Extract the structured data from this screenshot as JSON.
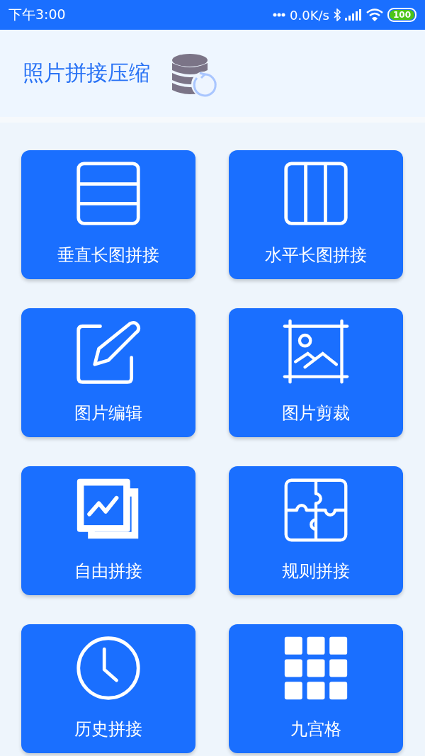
{
  "status_bar": {
    "time": "下午3:00",
    "network_speed": "0.0K/s",
    "battery": "100"
  },
  "header": {
    "title": "照片拼接压缩"
  },
  "tiles": [
    {
      "label": "垂直长图拼接"
    },
    {
      "label": "水平长图拼接"
    },
    {
      "label": "图片编辑"
    },
    {
      "label": "图片剪裁"
    },
    {
      "label": "自由拼接"
    },
    {
      "label": "规则拼接"
    },
    {
      "label": "历史拼接"
    },
    {
      "label": "九宫格"
    }
  ]
}
